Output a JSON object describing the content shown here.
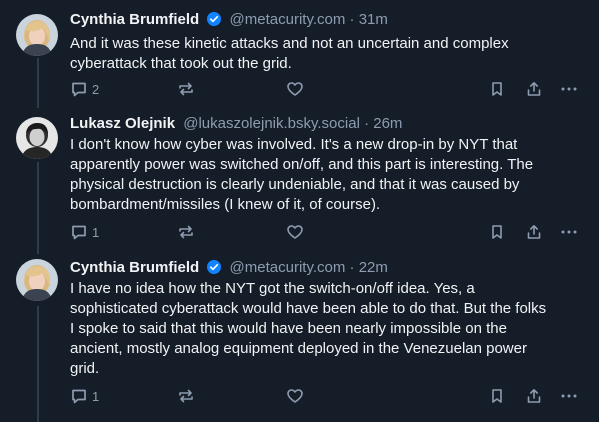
{
  "colors": {
    "background": "#151d28",
    "text": "#f1f3f5",
    "muted": "#8d9cb0",
    "verified": "#1083fe"
  },
  "posts": [
    {
      "author_name": "Cynthia Brumfield",
      "verified": true,
      "handle": "@metacurity.com",
      "separator": "·",
      "time": "31m",
      "text": "And it was these kinetic attacks and not an uncertain and complex\ncyberattack that took out the grid.",
      "reply_count": "2",
      "repost_count": "",
      "like_count": "",
      "avatar_icon": "avatar-woman-blonde"
    },
    {
      "author_name": "Lukasz Olejnik",
      "verified": false,
      "handle": "@lukaszolejnik.bsky.social",
      "separator": "·",
      "time": "26m",
      "text": "I don't know how cyber was involved. It's a new drop-in by NYT that\napparently power was switched on/off, and this part is interesting. The\nphysical destruction is clearly undeniable, and that it was caused by\nbombardment/missiles (I knew of it, of course).",
      "reply_count": "1",
      "repost_count": "",
      "like_count": "",
      "avatar_icon": "avatar-man-bw"
    },
    {
      "author_name": "Cynthia Brumfield",
      "verified": true,
      "handle": "@metacurity.com",
      "separator": "·",
      "time": "22m",
      "text": "I have no idea how the NYT got the switch-on/off idea. Yes, a\nsophisticated cyberattack would have been able to do that. But the folks\nI spoke to said that this would have been nearly impossible on the\nancient, mostly analog equipment deployed in the Venezuelan power\ngrid.",
      "reply_count": "1",
      "repost_count": "",
      "like_count": "",
      "avatar_icon": "avatar-woman-blonde"
    }
  ]
}
